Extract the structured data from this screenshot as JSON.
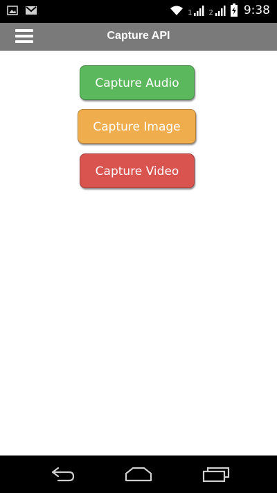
{
  "status_bar": {
    "left_icons": [
      "image-icon",
      "gmail-icon"
    ],
    "sim1_label": "1",
    "sim2_label": "2",
    "time": "9:38"
  },
  "header": {
    "title": "Capture API",
    "menu_icon": "hamburger-menu-icon"
  },
  "buttons": {
    "audio": {
      "label": "Capture Audio",
      "color": "#5cb85c"
    },
    "image": {
      "label": "Capture Image",
      "color": "#f0ad4e"
    },
    "video": {
      "label": "Capture Video",
      "color": "#d9534f"
    }
  },
  "nav_bar": {
    "icons": [
      "back-icon",
      "home-icon",
      "recents-icon"
    ]
  }
}
